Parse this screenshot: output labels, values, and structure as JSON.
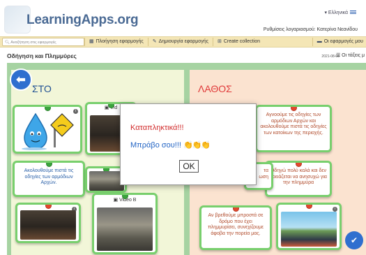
{
  "header": {
    "logo": "LearningApps.org",
    "language": "Ελληνικά",
    "user_line": "Ρυθμίσεις λογαριασμού: Κατερίνα Νεανίδου"
  },
  "nav": {
    "search_placeholder": "Αναζήτηση στις εφαρμογές",
    "items": [
      {
        "icon": "grid-icon",
        "label": "Πλοήγηση εφαρμογής"
      },
      {
        "icon": "pencil-icon",
        "label": "Δημιουργία εφαρμογής"
      },
      {
        "icon": "collection-icon",
        "label": "Create collection"
      }
    ],
    "my_apps": "Οι εφαρμογές μου"
  },
  "subheader": {
    "title": "Οδήγηση και Πλημμύρες",
    "date": "2021-08-08",
    "classes": "Οι τάξεις μ"
  },
  "board": {
    "left_title": "ΣΤΟ",
    "right_title": "ΛΑΘΟΣ",
    "cards": {
      "c_left_text": "Ακολουθούμε πιστά τις οδηγίες των αρμόδιων Αρχών.",
      "c_video_a_label": "Vid",
      "c_video_b_label": "Video B",
      "c_right1": "Αγνοούμε τις οδηγίες των αρμόδιων Αρχών και ακολουθούμε πιστά τις οδηγίες των κατοίκων της περιοχής.",
      "c_right2": "Οδηγώ πολύ καλά και δεν χρειάζεται να ανησυχώ για την πλημμύρα",
      "c_right3": "Αν βρεθούμε μπροστά σε δρόμο που έχει πλημμυρίσει, συνεχίζουμε άφοβα την πορεία μας.",
      "c_hidden1": "τα",
      "c_hidden2": "ωση"
    }
  },
  "modal": {
    "line1": "Καταπληκτικά!!!",
    "line2": "Μπράβο σου!!!",
    "claps": "👏👏👏",
    "ok": "OK"
  },
  "colors": {
    "board_green": "#a6d3a2",
    "correct_col": "#f2f6d8",
    "wrong_col": "#fbe3d0",
    "card_border": "#78cf6d",
    "nav_bg": "#f4e6b6",
    "brand_blue": "#2f6fcf"
  }
}
